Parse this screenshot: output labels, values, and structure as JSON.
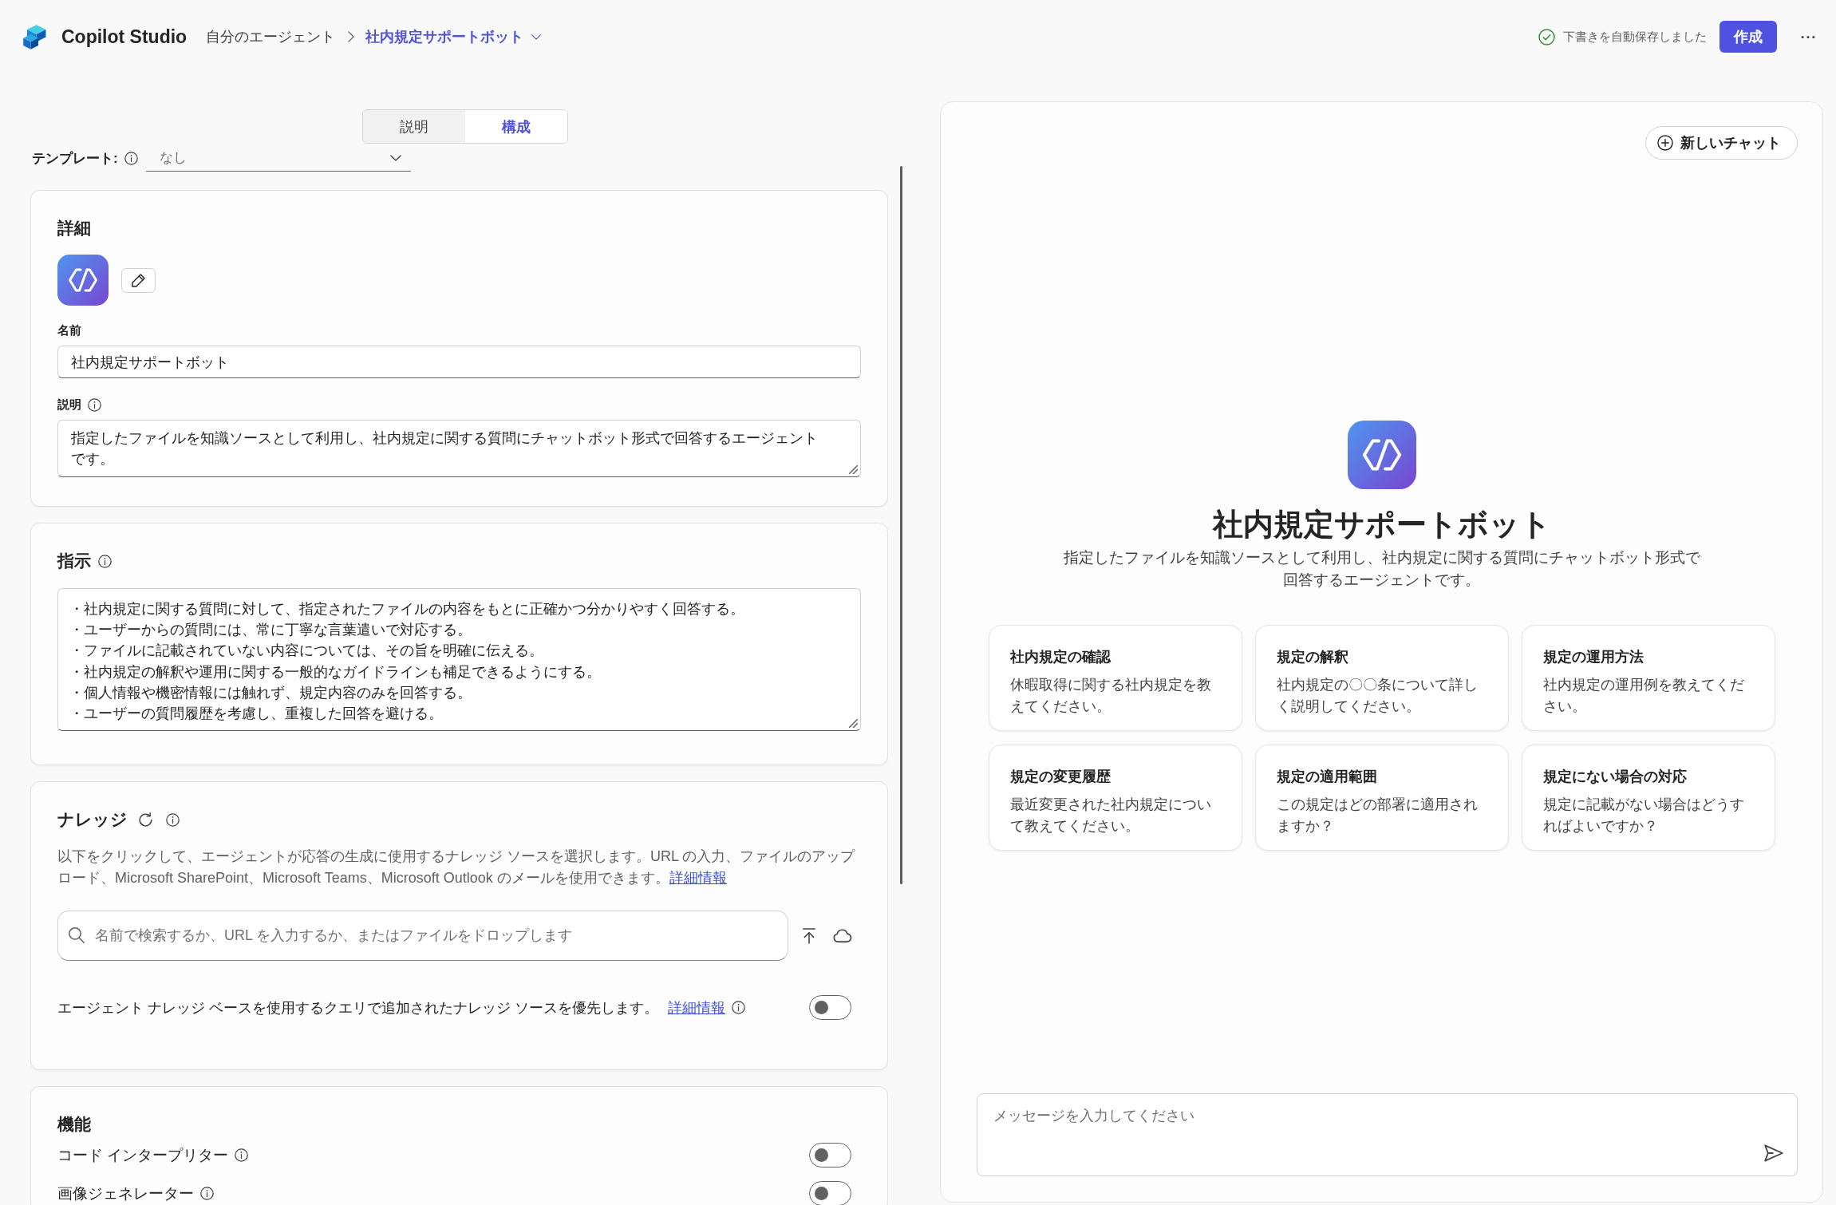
{
  "header": {
    "product": "Copilot Studio",
    "breadcrumb": {
      "parent": "自分のエージェント",
      "current": "社内規定サポートボット"
    },
    "autosave_status": "下書きを自動保存しました",
    "create_button": "作成"
  },
  "tabs": [
    {
      "label": "説明",
      "selected": false
    },
    {
      "label": "構成",
      "selected": true
    }
  ],
  "template": {
    "label": "テンプレート:",
    "value": "なし"
  },
  "details": {
    "title": "詳細",
    "name_label": "名前",
    "name_value": "社内規定サポートボット",
    "description_label": "説明",
    "description_value": "指定したファイルを知識ソースとして利用し、社内規定に関する質問にチャットボット形式で回答するエージェントです。"
  },
  "instructions": {
    "title": "指示",
    "lines": [
      "・社内規定に関する質問に対して、指定されたファイルの内容をもとに正確かつ分かりやすく回答する。",
      "・ユーザーからの質問には、常に丁寧な言葉遣いで対応する。",
      "・ファイルに記載されていない内容については、その旨を明確に伝える。",
      "・社内規定の解釈や運用に関する一般的なガイドラインも補足できるようにする。",
      "・個人情報や機密情報には触れず、規定内容のみを回答する。",
      "・ユーザーの質問履歴を考慮し、重複した回答を避ける。"
    ]
  },
  "knowledge": {
    "title": "ナレッジ",
    "description": "以下をクリックして、エージェントが応答の生成に使用するナレッジ ソースを選択します。URL の入力、ファイルのアップロード、Microsoft SharePoint、Microsoft Teams、Microsoft Outlook のメールを使用できます。",
    "description_link": "詳細情報",
    "search_field": {
      "placeholder": "名前で検索するか、URL を入力するか、またはファイルをドロップします"
    },
    "priority_setting": {
      "label": "エージェント ナレッジ ベースを使用するクエリで追加されたナレッジ ソースを優先します。",
      "link": "詳細情報",
      "on": false
    }
  },
  "capabilities": {
    "title": "機能",
    "items": [
      {
        "label": "コード インタープリター",
        "on": false
      },
      {
        "label": "画像ジェネレーター",
        "on": false
      }
    ]
  },
  "preview": {
    "new_chat_button": "新しいチャット",
    "agent_name": "社内規定サポートボット",
    "agent_description": "指定したファイルを知識ソースとして利用し、社内規定に関する質問にチャットボット形式で回答するエージェントです。",
    "suggestions": [
      {
        "title": "社内規定の確認",
        "text": "休暇取得に関する社内規定を教えてください。"
      },
      {
        "title": "規定の解釈",
        "text": "社内規定の〇〇条について詳しく説明してください。"
      },
      {
        "title": "規定の運用方法",
        "text": "社内規定の運用例を教えてください。"
      },
      {
        "title": "規定の変更履歴",
        "text": "最近変更された社内規定について教えてください。"
      },
      {
        "title": "規定の適用範囲",
        "text": "この規定はどの部署に適用されますか？"
      },
      {
        "title": "規定にない場合の対応",
        "text": "規定に記載がない場合はどうすればよいですか？"
      }
    ],
    "message_field": {
      "placeholder": "メッセージを入力してください"
    }
  }
}
